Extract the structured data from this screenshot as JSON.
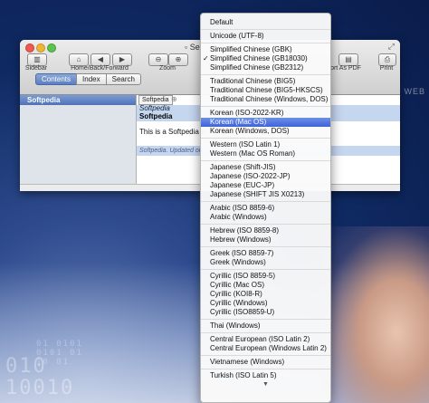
{
  "background": {
    "digits_large": "010\n10010",
    "digits_small": "01 0101\n0101 01\n10 01",
    "word": "WEB"
  },
  "window": {
    "title": "Se",
    "toolbar": {
      "sidebar_label": "Sidebar",
      "nav_label": "Home/Back/Forward",
      "zoom_label": "Zoom",
      "export_label": "ort As PDF",
      "print_label": "Print"
    },
    "sidebar_tabs": [
      {
        "label": "Contents"
      },
      {
        "label": "Index"
      },
      {
        "label": "Search"
      }
    ],
    "sidebar_items": [
      {
        "label": "Softpedia"
      }
    ],
    "document_tab": "Softpedia",
    "header_italic": "Softpedia",
    "header_bold": "Softpedia",
    "body_text": "This is a Softpedia te",
    "footer_text": "Softpedia. Updated on"
  },
  "encoding_menu": {
    "selected": "Simplified Chinese (GB18030)",
    "highlighted": "Korean (Mac OS)",
    "groups": [
      [
        "Default"
      ],
      [
        "Unicode (UTF-8)"
      ],
      [
        "Simplified Chinese (GBK)",
        "Simplified Chinese (GB18030)",
        "Simplified Chinese (GB2312)"
      ],
      [
        "Traditional Chinese (BIG5)",
        "Traditional Chinese (BIG5-HKSCS)",
        "Traditional Chinese (Windows, DOS)"
      ],
      [
        "Korean (ISO-2022-KR)",
        "Korean (Mac OS)",
        "Korean (Windows, DOS)"
      ],
      [
        "Western (ISO Latin 1)",
        "Western (Mac OS Roman)"
      ],
      [
        "Japanese (Shift-JIS)",
        "Japanese (ISO-2022-JP)",
        "Japanese (EUC-JP)",
        "Japanese (SHIFT JIS X0213)"
      ],
      [
        "Arabic (ISO 8859-6)",
        "Arabic (Windows)"
      ],
      [
        "Hebrew (ISO 8859-8)",
        "Hebrew (Windows)"
      ],
      [
        "Greek (ISO 8859-7)",
        "Greek (Windows)"
      ],
      [
        "Cyrillic (ISO 8859-5)",
        "Cyrillic (Mac OS)",
        "Cyrillic (KOI8-R)",
        "Cyrillic (Windows)",
        "Cyrillic (ISO8859-U)"
      ],
      [
        "Thai (Windows)"
      ],
      [
        "Central European (ISO Latin 2)",
        "Central European (Windows Latin 2)"
      ],
      [
        "Vietnamese (Windows)"
      ],
      [
        "Turkish (ISO Latin 5)"
      ]
    ],
    "more_indicator": "▼"
  }
}
